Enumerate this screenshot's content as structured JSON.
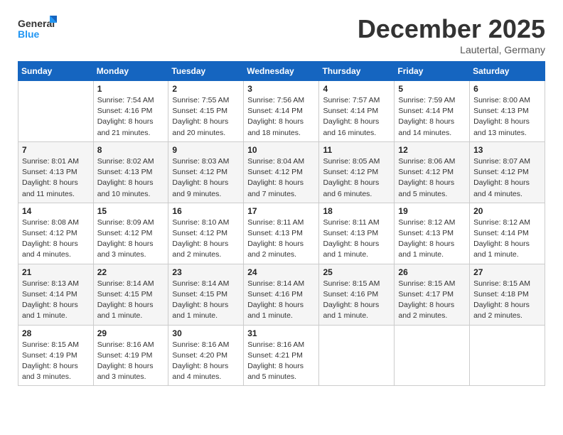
{
  "header": {
    "logo_general": "General",
    "logo_blue": "Blue",
    "month_title": "December 2025",
    "location": "Lautertal, Germany"
  },
  "weekdays": [
    "Sunday",
    "Monday",
    "Tuesday",
    "Wednesday",
    "Thursday",
    "Friday",
    "Saturday"
  ],
  "weeks": [
    [
      {
        "day": "",
        "info": ""
      },
      {
        "day": "1",
        "info": "Sunrise: 7:54 AM\nSunset: 4:16 PM\nDaylight: 8 hours\nand 21 minutes."
      },
      {
        "day": "2",
        "info": "Sunrise: 7:55 AM\nSunset: 4:15 PM\nDaylight: 8 hours\nand 20 minutes."
      },
      {
        "day": "3",
        "info": "Sunrise: 7:56 AM\nSunset: 4:14 PM\nDaylight: 8 hours\nand 18 minutes."
      },
      {
        "day": "4",
        "info": "Sunrise: 7:57 AM\nSunset: 4:14 PM\nDaylight: 8 hours\nand 16 minutes."
      },
      {
        "day": "5",
        "info": "Sunrise: 7:59 AM\nSunset: 4:14 PM\nDaylight: 8 hours\nand 14 minutes."
      },
      {
        "day": "6",
        "info": "Sunrise: 8:00 AM\nSunset: 4:13 PM\nDaylight: 8 hours\nand 13 minutes."
      }
    ],
    [
      {
        "day": "7",
        "info": "Sunrise: 8:01 AM\nSunset: 4:13 PM\nDaylight: 8 hours\nand 11 minutes."
      },
      {
        "day": "8",
        "info": "Sunrise: 8:02 AM\nSunset: 4:13 PM\nDaylight: 8 hours\nand 10 minutes."
      },
      {
        "day": "9",
        "info": "Sunrise: 8:03 AM\nSunset: 4:12 PM\nDaylight: 8 hours\nand 9 minutes."
      },
      {
        "day": "10",
        "info": "Sunrise: 8:04 AM\nSunset: 4:12 PM\nDaylight: 8 hours\nand 7 minutes."
      },
      {
        "day": "11",
        "info": "Sunrise: 8:05 AM\nSunset: 4:12 PM\nDaylight: 8 hours\nand 6 minutes."
      },
      {
        "day": "12",
        "info": "Sunrise: 8:06 AM\nSunset: 4:12 PM\nDaylight: 8 hours\nand 5 minutes."
      },
      {
        "day": "13",
        "info": "Sunrise: 8:07 AM\nSunset: 4:12 PM\nDaylight: 8 hours\nand 4 minutes."
      }
    ],
    [
      {
        "day": "14",
        "info": "Sunrise: 8:08 AM\nSunset: 4:12 PM\nDaylight: 8 hours\nand 4 minutes."
      },
      {
        "day": "15",
        "info": "Sunrise: 8:09 AM\nSunset: 4:12 PM\nDaylight: 8 hours\nand 3 minutes."
      },
      {
        "day": "16",
        "info": "Sunrise: 8:10 AM\nSunset: 4:12 PM\nDaylight: 8 hours\nand 2 minutes."
      },
      {
        "day": "17",
        "info": "Sunrise: 8:11 AM\nSunset: 4:13 PM\nDaylight: 8 hours\nand 2 minutes."
      },
      {
        "day": "18",
        "info": "Sunrise: 8:11 AM\nSunset: 4:13 PM\nDaylight: 8 hours\nand 1 minute."
      },
      {
        "day": "19",
        "info": "Sunrise: 8:12 AM\nSunset: 4:13 PM\nDaylight: 8 hours\nand 1 minute."
      },
      {
        "day": "20",
        "info": "Sunrise: 8:12 AM\nSunset: 4:14 PM\nDaylight: 8 hours\nand 1 minute."
      }
    ],
    [
      {
        "day": "21",
        "info": "Sunrise: 8:13 AM\nSunset: 4:14 PM\nDaylight: 8 hours\nand 1 minute."
      },
      {
        "day": "22",
        "info": "Sunrise: 8:14 AM\nSunset: 4:15 PM\nDaylight: 8 hours\nand 1 minute."
      },
      {
        "day": "23",
        "info": "Sunrise: 8:14 AM\nSunset: 4:15 PM\nDaylight: 8 hours\nand 1 minute."
      },
      {
        "day": "24",
        "info": "Sunrise: 8:14 AM\nSunset: 4:16 PM\nDaylight: 8 hours\nand 1 minute."
      },
      {
        "day": "25",
        "info": "Sunrise: 8:15 AM\nSunset: 4:16 PM\nDaylight: 8 hours\nand 1 minute."
      },
      {
        "day": "26",
        "info": "Sunrise: 8:15 AM\nSunset: 4:17 PM\nDaylight: 8 hours\nand 2 minutes."
      },
      {
        "day": "27",
        "info": "Sunrise: 8:15 AM\nSunset: 4:18 PM\nDaylight: 8 hours\nand 2 minutes."
      }
    ],
    [
      {
        "day": "28",
        "info": "Sunrise: 8:15 AM\nSunset: 4:19 PM\nDaylight: 8 hours\nand 3 minutes."
      },
      {
        "day": "29",
        "info": "Sunrise: 8:16 AM\nSunset: 4:19 PM\nDaylight: 8 hours\nand 3 minutes."
      },
      {
        "day": "30",
        "info": "Sunrise: 8:16 AM\nSunset: 4:20 PM\nDaylight: 8 hours\nand 4 minutes."
      },
      {
        "day": "31",
        "info": "Sunrise: 8:16 AM\nSunset: 4:21 PM\nDaylight: 8 hours\nand 5 minutes."
      },
      {
        "day": "",
        "info": ""
      },
      {
        "day": "",
        "info": ""
      },
      {
        "day": "",
        "info": ""
      }
    ]
  ]
}
